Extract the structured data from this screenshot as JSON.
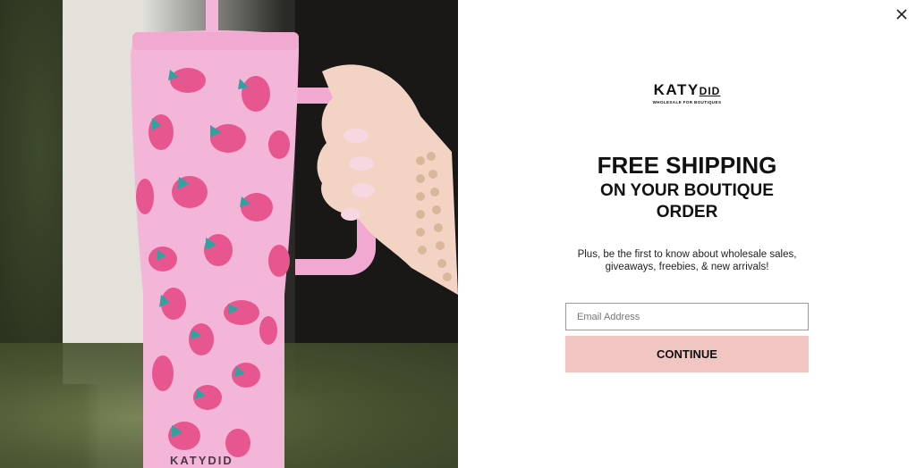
{
  "popup": {
    "close_icon": "close-icon",
    "logo": {
      "main": "KATY",
      "accent": "DID",
      "tagline": "WHOLESALE FOR BOUTIQUES"
    },
    "headline": {
      "line1": "FREE SHIPPING",
      "line2": "ON YOUR BOUTIQUE",
      "line3": "ORDER"
    },
    "subtext": "Plus, be the first to know about wholesale sales, giveaways, freebies, & new arrivals!",
    "email": {
      "placeholder": "Email Address",
      "value": ""
    },
    "continue_label": "CONTINUE",
    "photo": {
      "tumbler_brand": "KATYDID"
    },
    "colors": {
      "button_bg": "#f1c5c2",
      "text": "#111111",
      "tumbler_pink": "#f3b6d8",
      "strawberry": "#e8568f",
      "leaf": "#2fa3a0"
    }
  }
}
